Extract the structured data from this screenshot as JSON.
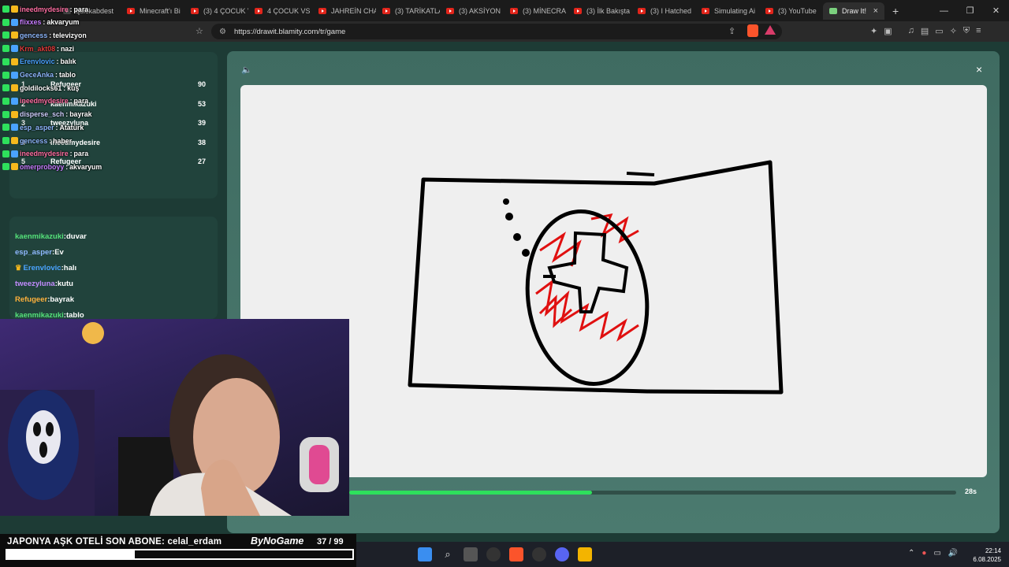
{
  "browser": {
    "tabs": [
      {
        "label": "quickabdest",
        "type": "quick"
      },
      {
        "label": "Minecraft'ı Bi",
        "type": "yt"
      },
      {
        "label": "(3) 4 ÇOCUK V",
        "type": "yt"
      },
      {
        "label": "4 ÇOCUK VS",
        "type": "yt"
      },
      {
        "label": "JAHREİN CHA",
        "type": "yt"
      },
      {
        "label": "(3) TARİKATLA",
        "type": "yt"
      },
      {
        "label": "(3) AKSİYON",
        "type": "yt"
      },
      {
        "label": "(3) MİNECRA",
        "type": "yt"
      },
      {
        "label": "(3) İlk Bakışta",
        "type": "yt"
      },
      {
        "label": "(3) I Hatched",
        "type": "yt"
      },
      {
        "label": "Simulating Ai",
        "type": "yt"
      },
      {
        "label": "(3) YouTube",
        "type": "yt"
      },
      {
        "label": "Draw It!",
        "type": "active"
      }
    ],
    "tab_close": "×",
    "new_tab": "+",
    "window_controls": [
      "—",
      "❐",
      "✕"
    ],
    "url": "https://drawit.blamity.com/tr/game"
  },
  "game": {
    "close": "×",
    "timer_label": "28s",
    "timer_progress": 0.4
  },
  "leaderboard": [
    {
      "rank": "1",
      "name": "Refugeer",
      "score": "90"
    },
    {
      "rank": "2",
      "name": "kaenmikazuki",
      "score": "53"
    },
    {
      "rank": "3",
      "name": "tweezyluna",
      "score": "39"
    },
    {
      "rank": "4",
      "name": "ineedmydesire",
      "score": "38"
    },
    {
      "rank": "5",
      "name": "Refugeer",
      "score": "27"
    }
  ],
  "guesses": [
    {
      "user": "kaenmikazuki",
      "word": "duvar",
      "color": "#55e27a",
      "crown": false
    },
    {
      "user": "esp_asper",
      "word": "Ev",
      "color": "#8fb8ff",
      "crown": false
    },
    {
      "user": "Erenvlovic",
      "word": "halı",
      "color": "#4aa3ff",
      "crown": true
    },
    {
      "user": "tweezyluna",
      "word": "kutu",
      "color": "#c38cff",
      "crown": false
    },
    {
      "user": "Refugeer",
      "word": "bayrak",
      "color": "#ffb13b",
      "crown": false
    },
    {
      "user": "kaenmikazuki",
      "word": "tablo",
      "color": "#55e27a",
      "crown": false
    }
  ],
  "chat": [
    {
      "user": "ineedmydesire",
      "msg": "para",
      "color": "#ff6fa3"
    },
    {
      "user": "flixxes",
      "msg": "akvaryum",
      "color": "#c77dff"
    },
    {
      "user": "gencess",
      "msg": "televizyon",
      "color": "#8fb8ff"
    },
    {
      "user": "Krm_akt08",
      "msg": "nazi",
      "color": "#e03a3a"
    },
    {
      "user": "Erenvlovic",
      "msg": "balık",
      "color": "#4aa3ff"
    },
    {
      "user": "GeceAnka",
      "msg": "tablo",
      "color": "#8fb8ff"
    },
    {
      "user": "goldilocks61",
      "msg": "kuş",
      "color": "#ffffff"
    },
    {
      "user": "ineedmydesire",
      "msg": "para",
      "color": "#ff6fa3"
    },
    {
      "user": "disperse_sch",
      "msg": "bayrak",
      "color": "#d0d0ff"
    },
    {
      "user": "esp_asper",
      "msg": "Atatürk",
      "color": "#8fb8ff"
    },
    {
      "user": "gencess",
      "msg": "haber",
      "color": "#8fb8ff"
    },
    {
      "user": "ineedmydesire",
      "msg": "para",
      "color": "#ff6fa3"
    },
    {
      "user": "omerproboyy",
      "msg": "akvaryum",
      "color": "#c77dff"
    }
  ],
  "overlay": {
    "left_text": "JAPONYA AŞK OTELİ   SON ABONE: celal_erdam",
    "brand": "ByNoGame",
    "count": "37  / 99",
    "progress": 0.37
  },
  "taskbar": {
    "time": "22:14",
    "date": "6.08.2025"
  }
}
